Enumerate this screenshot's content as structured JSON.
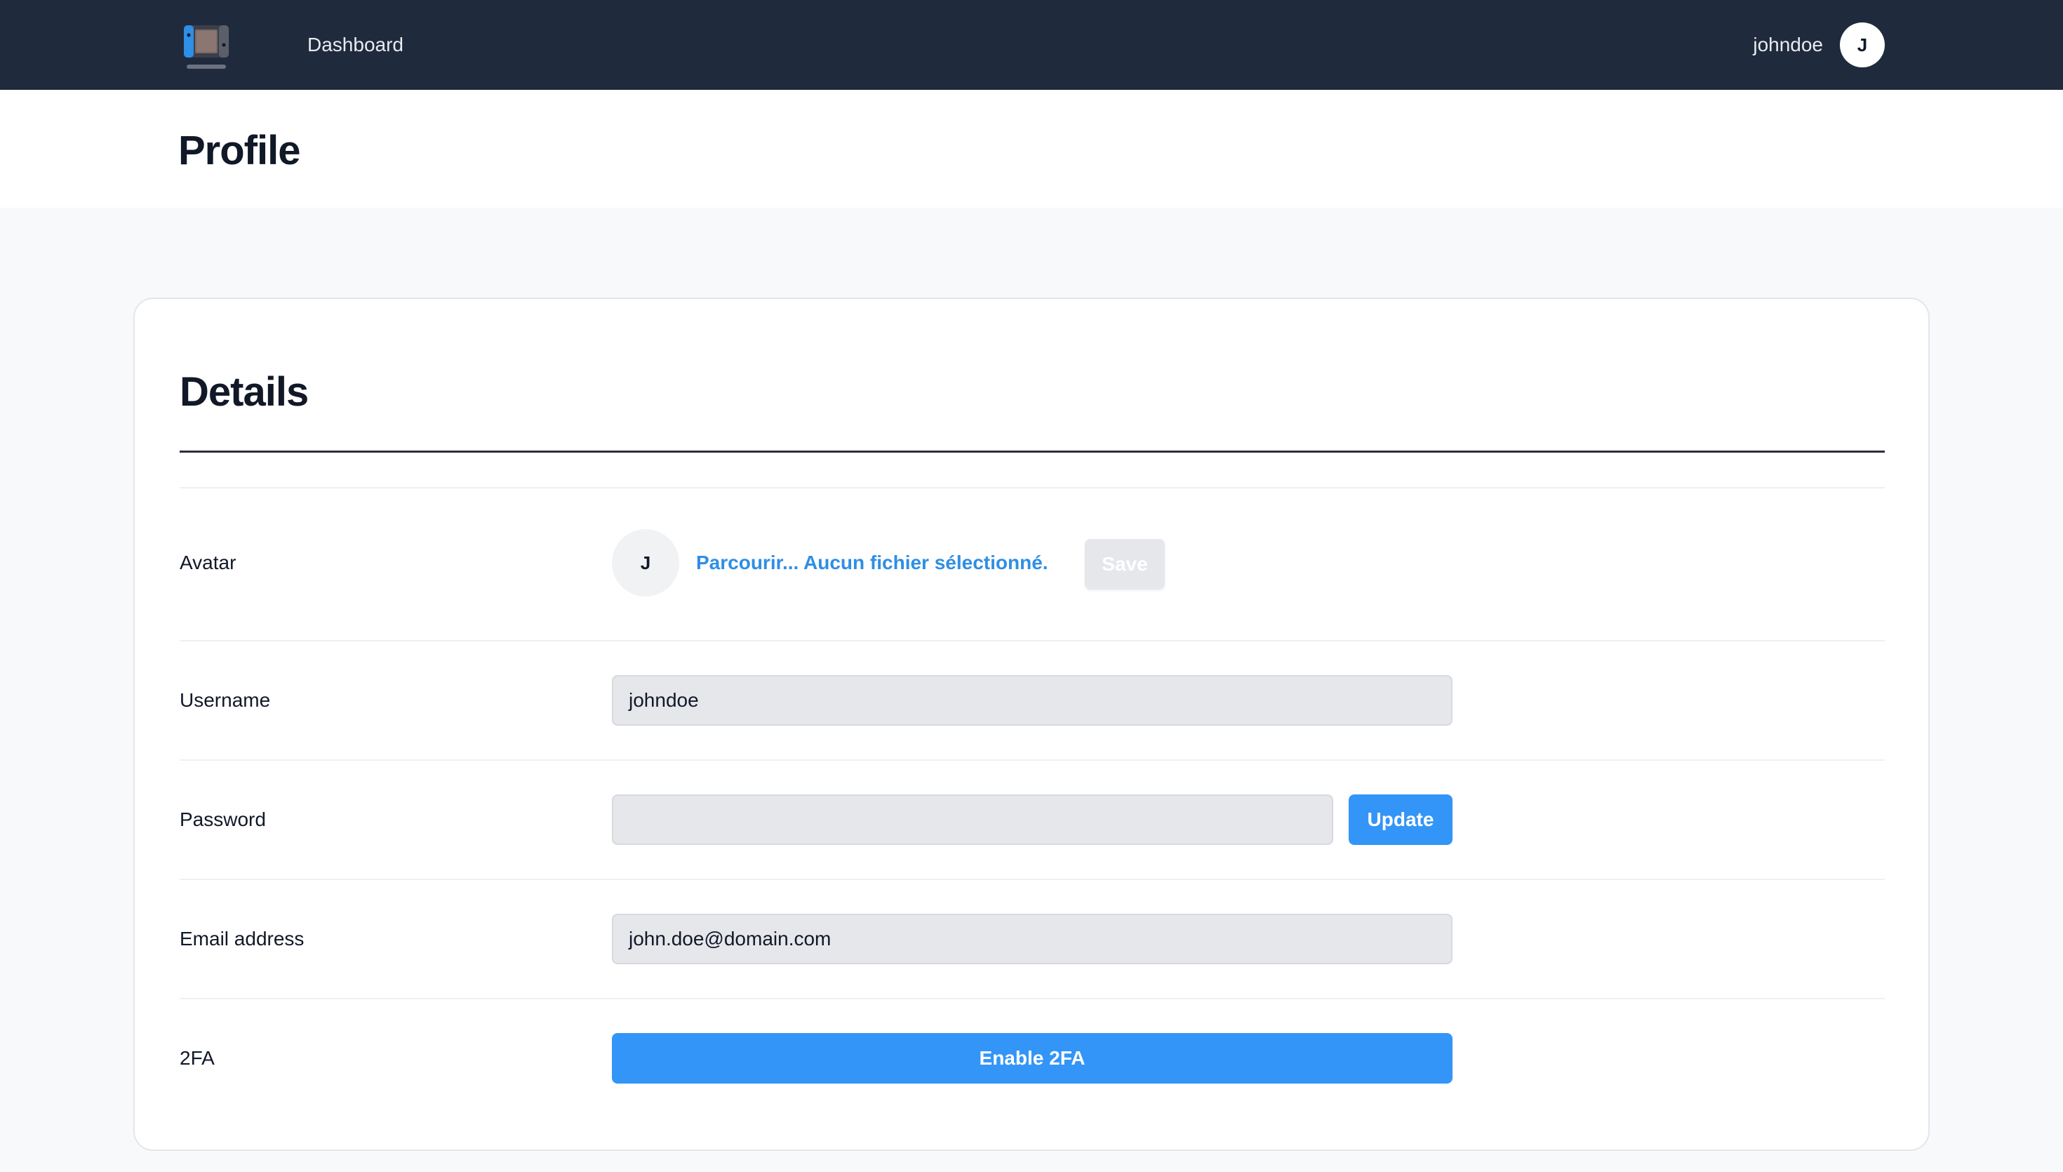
{
  "navbar": {
    "logo_icon": "handheld-console-icon",
    "dashboard_label": "Dashboard",
    "username": "johndoe",
    "avatar_initial": "J"
  },
  "header": {
    "title": "Profile"
  },
  "details": {
    "title": "Details",
    "avatar": {
      "label": "Avatar",
      "initial": "J",
      "file_input_text": "Parcourir... Aucun fichier sélectionné.",
      "save_label": "Save"
    },
    "username": {
      "label": "Username",
      "value": "johndoe"
    },
    "password": {
      "label": "Password",
      "value": "",
      "update_label": "Update"
    },
    "email": {
      "label": "Email address",
      "value": "john.doe@domain.com"
    },
    "twofa": {
      "label": "2FA",
      "button_label": "Enable 2FA"
    }
  },
  "colors": {
    "navbar_bg": "#1f2a3c",
    "primary": "#3395f7",
    "link": "#2f8ee5",
    "field_bg": "#e5e7eb"
  }
}
